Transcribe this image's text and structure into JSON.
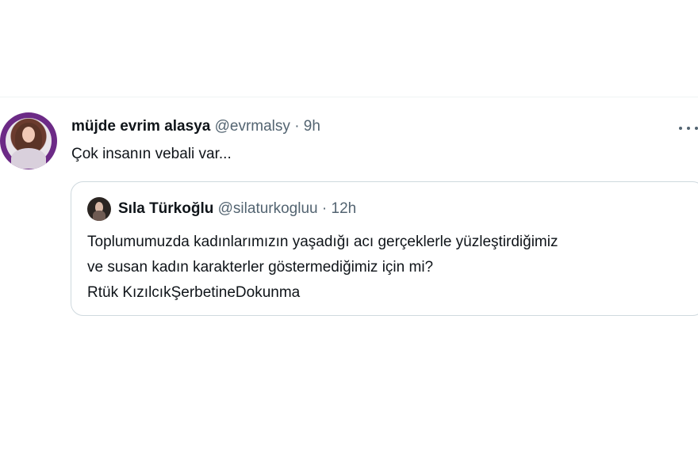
{
  "tweet": {
    "author": {
      "display_name": "müjde evrim alasya",
      "handle": "@evrmalsy",
      "separator": "·",
      "time": "9h",
      "avatar": "profile-photo-icon"
    },
    "text": "Çok insanın vebali var...",
    "more_icon": "more-horizontal-icon"
  },
  "quote": {
    "author": {
      "display_name": "Sıla Türkoğlu",
      "handle": "@silaturkogluu",
      "separator": "·",
      "time": "12h",
      "avatar": "profile-photo-icon"
    },
    "lines": [
      "Toplumumuzda kadınlarımızın yaşadığı acı gerçeklerle yüzleştirdiğimiz",
      "ve susan kadın karakterler göstermediğimiz için mi?",
      "Rtük KızılcıkŞerbetineDokunma"
    ]
  },
  "colors": {
    "text": "#0f1419",
    "secondary": "#536471",
    "border": "#cfd9de",
    "avatar_ring": "#6c2a86"
  }
}
